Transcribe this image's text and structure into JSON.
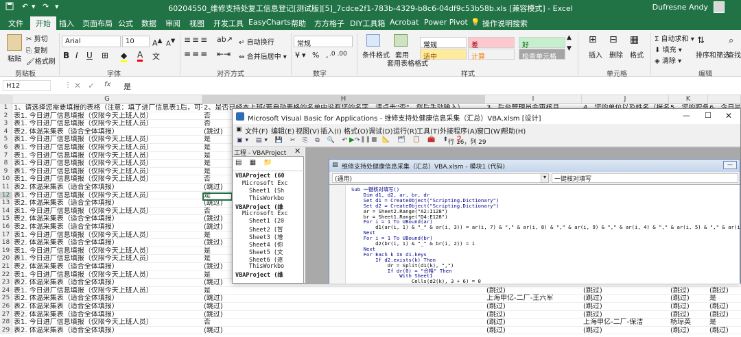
{
  "title_bar": {
    "title": "60204550_维修支持处复工信息登记[测试版][5]_7cdce2f1-783b-4329-b8c6-04df9c53b58b.xls [兼容模式] - Excel",
    "user": "Dufresne Andy"
  },
  "menu": [
    "文件",
    "开始",
    "插入",
    "页面布局",
    "公式",
    "数据",
    "审阅",
    "视图",
    "开发工具",
    "EasyCharts",
    "帮助",
    "方方格子",
    "DIY工具箱",
    "Acrobat",
    "Power Pivot",
    "操作说明搜索"
  ],
  "ribbon": {
    "clipboard": {
      "paste": "粘贴",
      "cut": "剪切",
      "copy": "复制",
      "format_painter": "格式刷",
      "group": "剪贴板"
    },
    "font": {
      "name": "Arial",
      "size": "10",
      "group": "字体",
      "bold": "B",
      "italic": "I",
      "underline": "U"
    },
    "alignment": {
      "wrap": "自动换行",
      "merge": "合并后居中",
      "group": "对齐方式"
    },
    "number": {
      "format": "常规",
      "group": "数字"
    },
    "styles": {
      "cond": "条件格式",
      "table": "套用表格格式",
      "group": "样式",
      "cells": [
        {
          "label": "常规",
          "bg": "#ffffff",
          "fg": "#000000"
        },
        {
          "label": "差",
          "bg": "#ffc7ce",
          "fg": "#9c0006"
        },
        {
          "label": "好",
          "bg": "#c6efce",
          "fg": "#006100"
        },
        {
          "label": "适中",
          "bg": "#ffeb9c",
          "fg": "#9c5700"
        },
        {
          "label": "计算",
          "bg": "#f2f2f2",
          "fg": "#fa7d00"
        },
        {
          "label": "检查单元格",
          "bg": "#a5a5a5",
          "fg": "#ffffff"
        }
      ]
    },
    "cells_grp": {
      "insert": "插入",
      "delete": "删除",
      "format": "格式",
      "group": "单元格"
    },
    "editing": {
      "autosum": "自动求和",
      "fill": "填充",
      "clear": "清除",
      "sort": "排序和筛选",
      "find": "查找和",
      "group": "编辑"
    }
  },
  "formula_bar": {
    "name_box": "H12",
    "fx": "fx",
    "value": "是"
  },
  "columns": [
    "G",
    "H",
    "I",
    "J",
    "K"
  ],
  "rows": [
    {
      "n": "1",
      "g": "1、请选择您需要填报的表格（注意：填了进厂信息表1后，可不填表2）",
      "h": "2、是否已经本上班(若自动表格的名单中没有您的名字，请点击\"否\"，然后手动输入）",
      "i": "3、后台管理员会审核且",
      "j": "4、您的单位以及姓名（报名上班人，您的单位）",
      "k": "5、您的职务&",
      "l": "6、今日是否"
    },
    {
      "n": "2",
      "g": "表1. 今日进厂信息填报（仅限今天上班人员）",
      "h": "否"
    },
    {
      "n": "3",
      "g": "表1. 今日进厂信息填报（仅限今天上班人员）",
      "h": "否"
    },
    {
      "n": "4",
      "g": "表2. 体温采集表（适合全体填报）",
      "h": "(跳过)"
    },
    {
      "n": "5",
      "g": "表1. 今日进厂信息填报（仅限今天上班人员）",
      "h": "是"
    },
    {
      "n": "6",
      "g": "表1. 今日进厂信息填报（仅限今天上班人员）",
      "h": "是"
    },
    {
      "n": "7",
      "g": "表1. 今日进厂信息填报（仅限今天上班人员）",
      "h": "是"
    },
    {
      "n": "8",
      "g": "表1. 今日进厂信息填报（仅限今天上班人员）",
      "h": "是"
    },
    {
      "n": "9",
      "g": "表1. 今日进厂信息填报（仅限今天上班人员）",
      "h": "是"
    },
    {
      "n": "10",
      "g": "表1. 今日进厂信息填报（仅限今天上班人员）",
      "h": "否"
    },
    {
      "n": "11",
      "g": "表2. 体温采集表（适合全体填报）",
      "h": "(跳过)"
    },
    {
      "n": "12",
      "g": "表1. 今日进厂信息填报（仅限今天上班人员）",
      "h": "是"
    },
    {
      "n": "13",
      "g": "表2. 体温采集表（适合全体填报）",
      "h": "(跳过)"
    },
    {
      "n": "14",
      "g": "表1. 今日进厂信息填报（仅限今天上班人员）",
      "h": "否"
    },
    {
      "n": "15",
      "g": "表2. 体温采集表（适合全体填报）",
      "h": "(跳过)"
    },
    {
      "n": "16",
      "g": "表2. 体温采集表（适合全体填报）",
      "h": "(跳过)"
    },
    {
      "n": "17",
      "g": "表1. 今日进厂信息填报（仅限今天上班人员）",
      "h": "是"
    },
    {
      "n": "18",
      "g": "表2. 体温采集表（适合全体填报）",
      "h": "(跳过)"
    },
    {
      "n": "19",
      "g": "表1. 今日进厂信息填报（仅限今天上班人员）",
      "h": "是"
    },
    {
      "n": "20",
      "g": "表1. 今日进厂信息填报（仅限今天上班人员）",
      "h": "是"
    },
    {
      "n": "21",
      "g": "表2. 体温采集表（适合全体填报）",
      "h": "(跳过)"
    },
    {
      "n": "22",
      "g": "表1. 今日进厂信息填报（仅限今天上班人员）",
      "h": "是"
    },
    {
      "n": "23",
      "g": "表2. 体温采集表（适合全体填报）",
      "h": "(跳过)"
    },
    {
      "n": "24",
      "g": "表1. 今日进厂信息填报（仅限今天上班人员）",
      "h": "是",
      "i": "(跳过)",
      "j": "(跳过)",
      "k": "(跳过)",
      "l": "(跳过)"
    },
    {
      "n": "25",
      "g": "表2. 体温采集表（适合全体填报）",
      "h": "(跳过)",
      "i": "上海申亿-二厂-王六军",
      "j": "(跳过)",
      "k": "(跳过)",
      "l": "是"
    },
    {
      "n": "26",
      "g": "表2. 体温采集表（适合全体填报）",
      "h": "(跳过)",
      "i": "(跳过)",
      "j": "(跳过)",
      "k": "(跳过)",
      "l": "(跳过)"
    },
    {
      "n": "27",
      "g": "表2. 体温采集表（适合全体填报）",
      "h": "(跳过)",
      "i": "(跳过)",
      "j": "(跳过)",
      "k": "(跳过)",
      "l": "(跳过)"
    },
    {
      "n": "28",
      "g": "表1. 今日进厂信息填报（仅限今天上班人员）",
      "h": "否",
      "i": "(跳过)",
      "j": "上海申亿-二厂-保洁",
      "k": "杨琼英",
      "l": "是"
    },
    {
      "n": "29",
      "g": "表2. 体温采集表（适合全体填报）",
      "h": "(跳过)",
      "i": "(跳过)",
      "j": "(跳过)",
      "k": "(跳过)",
      "l": "(跳过)"
    }
  ],
  "vba": {
    "title": "Microsoft Visual Basic for Applications - 维修支持处健康信息采集（汇总）VBA.xlsm [设计]",
    "menu": [
      "文件(F)",
      "编辑(E)",
      "视图(V)",
      "插入(I)",
      "格式(O)",
      "调试(D)",
      "运行(R)",
      "工具(T)",
      "外接程序(A)",
      "窗口(W)",
      "帮助(H)"
    ],
    "position": "行 16，列 29",
    "project_title": "工程 - VBAProject",
    "tree": [
      "VBAProject (60",
      "Microsoft Exc",
      "Sheet1 (Sh",
      "ThisWorkbo",
      "VBAProject (维",
      "Microsoft Exc",
      "Sheet1 (20",
      "Sheet2 (暂",
      "Sheet3 (增",
      "Sheet4 (你",
      "Sheet5 (文",
      "Sheet6 (逐",
      "ThisWorkbo",
      "VBAProject (维"
    ],
    "code_title": "维修支持处健康信息采集（汇总）VBA.xlsm - 模块1 (代码)",
    "object_combo": "(通用)",
    "proc_combo": "一键核对填写",
    "code": [
      "Sub 一键核对填写()",
      "    Dim d1, d2, ar, br, dr",
      "    Set d1 = CreateObject(\"Scripting.Dictionary\")",
      "    Set d2 = CreateObject(\"Scripting.Dictionary\")",
      "    ar = Sheet2.Range(\"A2:I128\")",
      "    br = Sheet1.Range(\"D4:E128\")",
      "    For i = 1 To UBound(ar)",
      "        d1(ar(i, 1) & \"_\" & ar(i, 3)) = ar(i, 7) & \",\" & ar(i, 8) & \",\" & ar(i, 9) & \",\" & ar(i, 4) & \",\" & ar(i, 5) & \",\" & ar(i, 6)",
      "    Next",
      "    For i = 1 To UBound(br)",
      "        d2(br(i, 1) & \"_\" & br(i, 2)) = i",
      "    Next",
      "    For Each k In d1.keys",
      "        If d2.exists(k) Then",
      "            dr = Split(d1(k), \",\")",
      "            If dr(0) = \"合格\" Then",
      "                With Sheet1",
      "                    Cells(d2(k), 3 + 6) = 0"
    ]
  }
}
